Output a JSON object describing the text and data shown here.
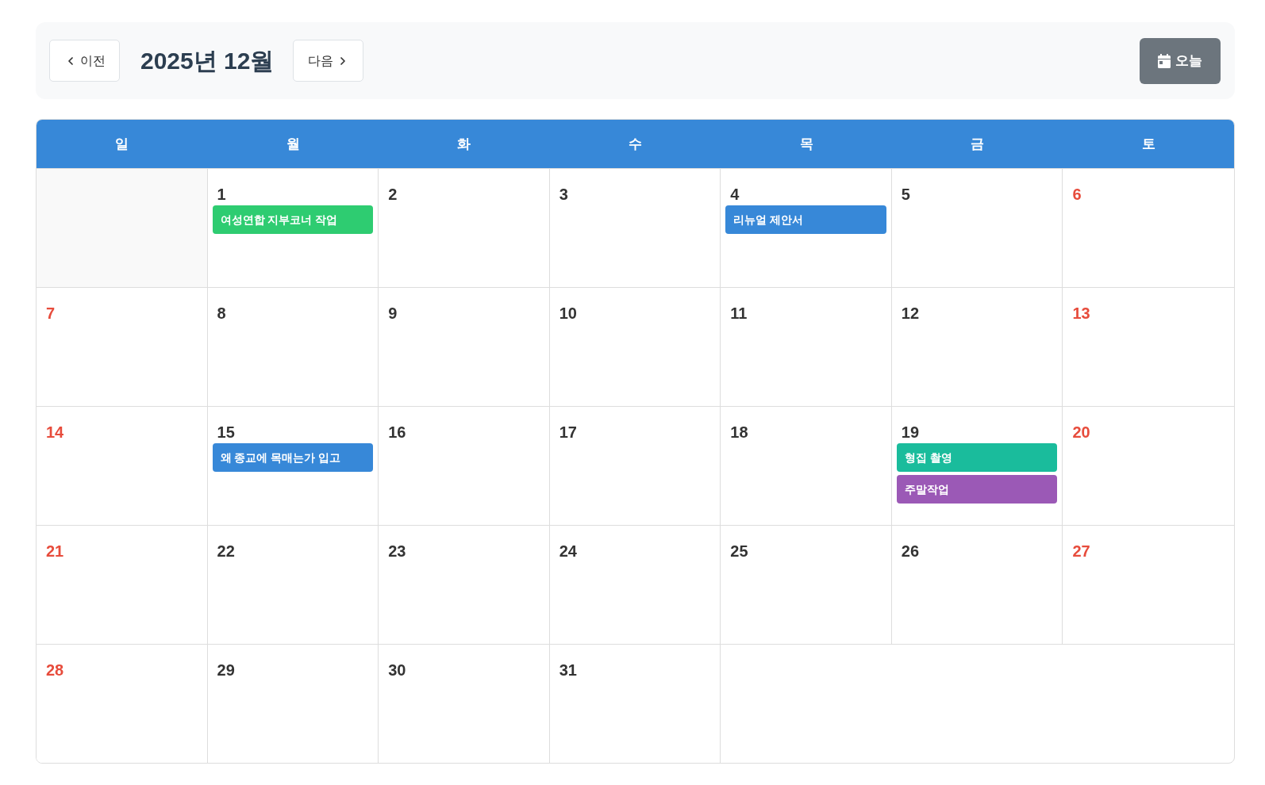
{
  "toolbar": {
    "prev_button": {
      "label": "이전"
    },
    "title": "2025년 12월",
    "next_button": {
      "label": "다음"
    },
    "today_button": {
      "label": "오늘"
    }
  },
  "calendar": {
    "weekdays": [
      "일",
      "월",
      "화",
      "수",
      "목",
      "금",
      "토"
    ],
    "weeks": [
      {
        "days": [
          {
            "kind": "blank"
          },
          {
            "kind": "day",
            "date": "1",
            "weekend": false,
            "events": [
              {
                "title": "여성연합 지부코너 작업",
                "color": "#2ecc71"
              }
            ]
          },
          {
            "kind": "day",
            "date": "2",
            "weekend": false
          },
          {
            "kind": "day",
            "date": "3",
            "weekend": false
          },
          {
            "kind": "day",
            "date": "4",
            "weekend": false,
            "events": [
              {
                "title": "리뉴얼 제안서",
                "color": "#3788d8"
              }
            ]
          },
          {
            "kind": "day",
            "date": "5",
            "weekend": false
          },
          {
            "kind": "day",
            "date": "6",
            "weekend": true
          }
        ]
      },
      {
        "days": [
          {
            "kind": "day",
            "date": "7",
            "weekend": true
          },
          {
            "kind": "day",
            "date": "8",
            "weekend": false
          },
          {
            "kind": "day",
            "date": "9",
            "weekend": false
          },
          {
            "kind": "day",
            "date": "10",
            "weekend": false
          },
          {
            "kind": "day",
            "date": "11",
            "weekend": false
          },
          {
            "kind": "day",
            "date": "12",
            "weekend": false
          },
          {
            "kind": "day",
            "date": "13",
            "weekend": true
          }
        ]
      },
      {
        "days": [
          {
            "kind": "day",
            "date": "14",
            "weekend": true
          },
          {
            "kind": "day",
            "date": "15",
            "weekend": false,
            "events": [
              {
                "title": "왜 종교에 목매는가 입고",
                "color": "#3788d8"
              }
            ]
          },
          {
            "kind": "day",
            "date": "16",
            "weekend": false
          },
          {
            "kind": "day",
            "date": "17",
            "weekend": false
          },
          {
            "kind": "day",
            "date": "18",
            "weekend": false
          },
          {
            "kind": "day",
            "date": "19",
            "weekend": false,
            "events": [
              {
                "title": "형집 촬영",
                "color": "#1abc9c"
              },
              {
                "title": "주말작업",
                "color": "#9b59b6"
              }
            ]
          },
          {
            "kind": "day",
            "date": "20",
            "weekend": true
          }
        ]
      },
      {
        "days": [
          {
            "kind": "day",
            "date": "21",
            "weekend": true
          },
          {
            "kind": "day",
            "date": "22",
            "weekend": false
          },
          {
            "kind": "day",
            "date": "23",
            "weekend": false
          },
          {
            "kind": "day",
            "date": "24",
            "weekend": false
          },
          {
            "kind": "day",
            "date": "25",
            "weekend": false
          },
          {
            "kind": "day",
            "date": "26",
            "weekend": false
          },
          {
            "kind": "day",
            "date": "27",
            "weekend": true
          }
        ]
      },
      {
        "days": [
          {
            "kind": "day",
            "date": "28",
            "weekend": true
          },
          {
            "kind": "day",
            "date": "29",
            "weekend": false
          },
          {
            "kind": "day",
            "date": "30",
            "weekend": false
          },
          {
            "kind": "day",
            "date": "31",
            "weekend": false
          }
        ]
      }
    ]
  }
}
